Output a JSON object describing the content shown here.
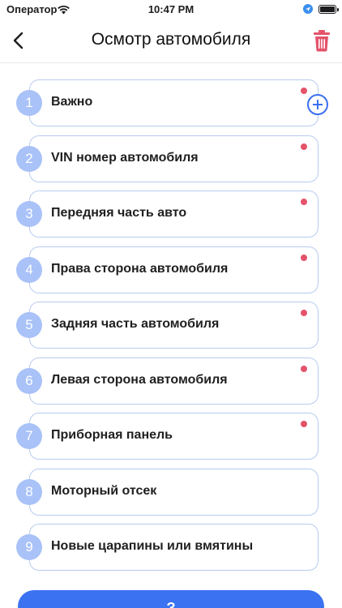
{
  "status_bar": {
    "carrier": "Оператор",
    "time": "10:47 PM"
  },
  "header": {
    "title": "Осмотр автомобиля",
    "back_icon": "chevron-left-icon",
    "delete_icon": "trash-icon",
    "delete_color": "#e4536a"
  },
  "sections": [
    {
      "number": "1",
      "label": "Важно",
      "has_alert": true
    },
    {
      "number": "2",
      "label": "VIN номер автомобиля",
      "has_alert": true
    },
    {
      "number": "3",
      "label": "Передняя часть авто",
      "has_alert": true
    },
    {
      "number": "4",
      "label": "Права сторона автомобиля",
      "has_alert": true
    },
    {
      "number": "5",
      "label": "Задняя часть автомобиля",
      "has_alert": true
    },
    {
      "number": "6",
      "label": "Левая сторона автомобиля",
      "has_alert": true
    },
    {
      "number": "7",
      "label": "Приборная панель",
      "has_alert": true
    },
    {
      "number": "8",
      "label": "Моторный отсек",
      "has_alert": false
    },
    {
      "number": "9",
      "label": "Новые царапины или вмятины",
      "has_alert": false
    }
  ],
  "colors": {
    "accent": "#3a72f2",
    "number_circle": "#a9c2f8",
    "card_border": "#b8cbf0",
    "alert_dot": "#e4536a"
  },
  "bottom_button": {
    "label": "З"
  }
}
